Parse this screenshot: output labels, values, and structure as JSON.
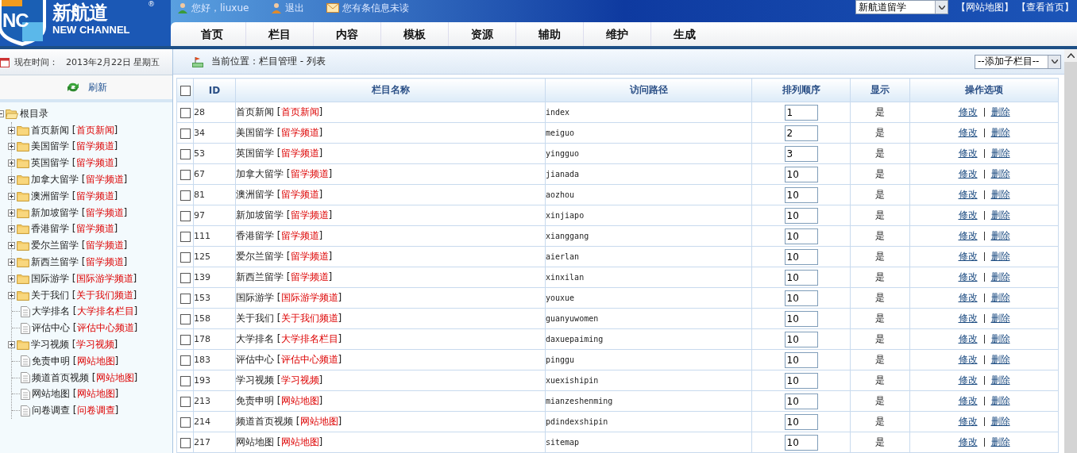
{
  "logo": {
    "mark": "NC",
    "name": "新航道",
    "name_en": "NEW CHANNEL",
    "registered": "®"
  },
  "topbar": {
    "greeting": "您好，liuxue",
    "logout": "退出",
    "messages": "您有条信息未读",
    "site_select": "新航道留学",
    "links": [
      "【网站地图】",
      "【查看首页】"
    ]
  },
  "nav": [
    {
      "label": "首页",
      "selected": false
    },
    {
      "label": "栏目",
      "selected": false
    },
    {
      "label": "内容",
      "selected": false
    },
    {
      "label": "模板",
      "selected": false
    },
    {
      "label": "资源",
      "selected": false
    },
    {
      "label": "辅助",
      "selected": false
    },
    {
      "label": "维护",
      "selected": false
    },
    {
      "label": "生成",
      "selected": false
    }
  ],
  "sidebar": {
    "time_label": "现在时间：",
    "date": "2013年2月22日  星期五",
    "refresh": "刷新",
    "tree": {
      "label": "根目录",
      "children": [
        {
          "kind": "folder",
          "label": "首页新闻 [*首页新闻*]"
        },
        {
          "kind": "folder",
          "label": "美国留学 [*留学频道*]"
        },
        {
          "kind": "folder",
          "label": "英国留学 [*留学频道*]"
        },
        {
          "kind": "folder",
          "label": "加拿大留学 [*留学频道*]"
        },
        {
          "kind": "folder",
          "label": "澳洲留学 [*留学频道*]"
        },
        {
          "kind": "folder",
          "label": "新加坡留学 [*留学频道*]"
        },
        {
          "kind": "folder",
          "label": "香港留学 [*留学频道*]"
        },
        {
          "kind": "folder",
          "label": "爱尔兰留学 [*留学频道*]"
        },
        {
          "kind": "folder",
          "label": "新西兰留学 [*留学频道*]"
        },
        {
          "kind": "folder",
          "label": "国际游学 [*国际游学频道*]"
        },
        {
          "kind": "folder",
          "label": "关于我们 [*关于我们频道*]"
        },
        {
          "kind": "page",
          "label": "大学排名 [*大学排名栏目*]"
        },
        {
          "kind": "page",
          "label": "评估中心 [*评估中心频道*]"
        },
        {
          "kind": "folder",
          "label": "学习视频 [*学习视频*]"
        },
        {
          "kind": "page",
          "label": "免责申明 [*网站地图*]"
        },
        {
          "kind": "page",
          "label": "频道首页视频 [*网站地图*]"
        },
        {
          "kind": "page",
          "label": "网站地图 [*网站地图*]"
        },
        {
          "kind": "page",
          "label": "问卷调查 [*问卷调查*]"
        }
      ]
    }
  },
  "breadcrumb": "当前位置：栏目管理 - 列表",
  "add_select": "--添加子栏目--",
  "table": {
    "select_all": false,
    "columns": [
      "ID",
      "栏目名称",
      "访问路径",
      "排列顺序",
      "显示",
      "操作选项"
    ],
    "rows": [
      {
        "checked": false,
        "id": "28",
        "name": "首页新闻 [*首页新闻*]",
        "path": "index",
        "order": "1",
        "show": "是",
        "edit": "修改",
        "delete": "删除"
      },
      {
        "checked": false,
        "id": "34",
        "name": "美国留学 [*留学频道*]",
        "path": "meiguo",
        "order": "2",
        "show": "是",
        "edit": "修改",
        "delete": "删除"
      },
      {
        "checked": false,
        "id": "53",
        "name": "英国留学 [*留学频道*]",
        "path": "yingguo",
        "order": "3",
        "show": "是",
        "edit": "修改",
        "delete": "删除"
      },
      {
        "checked": false,
        "id": "67",
        "name": "加拿大留学 [*留学频道*]",
        "path": "jianada",
        "order": "10",
        "show": "是",
        "edit": "修改",
        "delete": "删除"
      },
      {
        "checked": false,
        "id": "81",
        "name": "澳洲留学 [*留学频道*]",
        "path": "aozhou",
        "order": "10",
        "show": "是",
        "edit": "修改",
        "delete": "删除"
      },
      {
        "checked": false,
        "id": "97",
        "name": "新加坡留学 [*留学频道*]",
        "path": "xinjiapo",
        "order": "10",
        "show": "是",
        "edit": "修改",
        "delete": "删除"
      },
      {
        "checked": false,
        "id": "111",
        "name": "香港留学 [*留学频道*]",
        "path": "xianggang",
        "order": "10",
        "show": "是",
        "edit": "修改",
        "delete": "删除"
      },
      {
        "checked": false,
        "id": "125",
        "name": "爱尔兰留学 [*留学频道*]",
        "path": "aierlan",
        "order": "10",
        "show": "是",
        "edit": "修改",
        "delete": "删除"
      },
      {
        "checked": false,
        "id": "139",
        "name": "新西兰留学 [*留学频道*]",
        "path": "xinxilan",
        "order": "10",
        "show": "是",
        "edit": "修改",
        "delete": "删除"
      },
      {
        "checked": false,
        "id": "153",
        "name": "国际游学 [*国际游学频道*]",
        "path": "youxue",
        "order": "10",
        "show": "是",
        "edit": "修改",
        "delete": "删除"
      },
      {
        "checked": false,
        "id": "158",
        "name": "关于我们 [*关于我们频道*]",
        "path": "guanyuwomen",
        "order": "10",
        "show": "是",
        "edit": "修改",
        "delete": "删除"
      },
      {
        "checked": false,
        "id": "178",
        "name": "大学排名 [*大学排名栏目*]",
        "path": "daxuepaiming",
        "order": "10",
        "show": "是",
        "edit": "修改",
        "delete": "删除"
      },
      {
        "checked": false,
        "id": "183",
        "name": "评估中心 [*评估中心频道*]",
        "path": "pinggu",
        "order": "10",
        "show": "是",
        "edit": "修改",
        "delete": "删除"
      },
      {
        "checked": false,
        "id": "193",
        "name": "学习视频 [*学习视频*]",
        "path": "xuexishipin",
        "order": "10",
        "show": "是",
        "edit": "修改",
        "delete": "删除"
      },
      {
        "checked": false,
        "id": "213",
        "name": "免责申明 [*网站地图*]",
        "path": "mianzeshenming",
        "order": "10",
        "show": "是",
        "edit": "修改",
        "delete": "删除"
      },
      {
        "checked": false,
        "id": "214",
        "name": "频道首页视频 [*网站地图*]",
        "path": "pdindexshipin",
        "order": "10",
        "show": "是",
        "edit": "修改",
        "delete": "删除"
      },
      {
        "checked": false,
        "id": "217",
        "name": "网站地图 [*网站地图*]",
        "path": "sitemap",
        "order": "10",
        "show": "是",
        "edit": "修改",
        "delete": "删除"
      }
    ]
  }
}
